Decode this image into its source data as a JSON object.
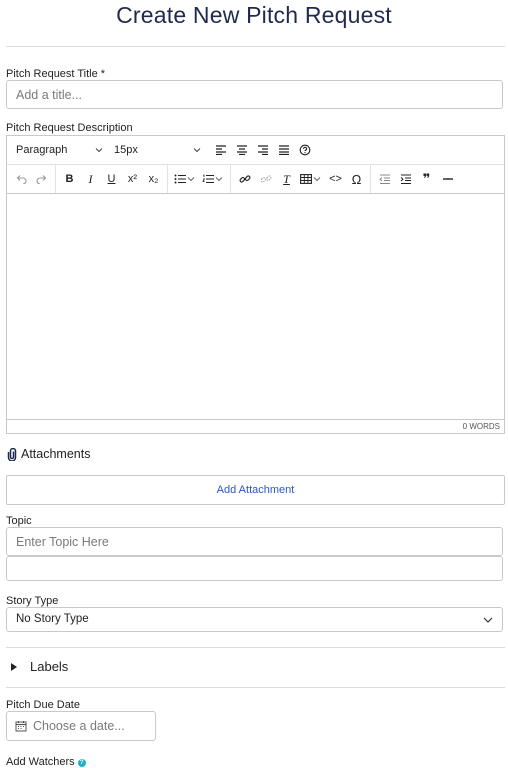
{
  "page": {
    "title": "Create New Pitch Request"
  },
  "title_field": {
    "label": "Pitch Request Title *",
    "placeholder": "Add a title..."
  },
  "description": {
    "label": "Pitch Request Description",
    "toolbar": {
      "block_format": "Paragraph",
      "font_size": "15px",
      "buttons": {
        "bold": "B",
        "italic": "I",
        "underline": "U",
        "superscript": "x²",
        "subscript": "x₂",
        "clear_format": "T",
        "code": "<>",
        "special_char": "Ω",
        "blockquote": "❞"
      }
    },
    "word_count": "0 WORDS"
  },
  "attachments": {
    "heading": "Attachments",
    "add_label": "Add Attachment"
  },
  "topic": {
    "label": "Topic",
    "placeholder": "Enter Topic Here"
  },
  "story_type": {
    "label": "Story Type",
    "selected": "No Story Type"
  },
  "labels_section": {
    "label": "Labels"
  },
  "due_date": {
    "label": "Pitch Due Date",
    "placeholder": "Choose a date..."
  },
  "watchers": {
    "label": "Add Watchers",
    "help": "?"
  },
  "colors": {
    "title": "#1f2a4d",
    "link": "#2d55c8",
    "border": "#c9c9c9",
    "help": "#1fb0cc"
  }
}
